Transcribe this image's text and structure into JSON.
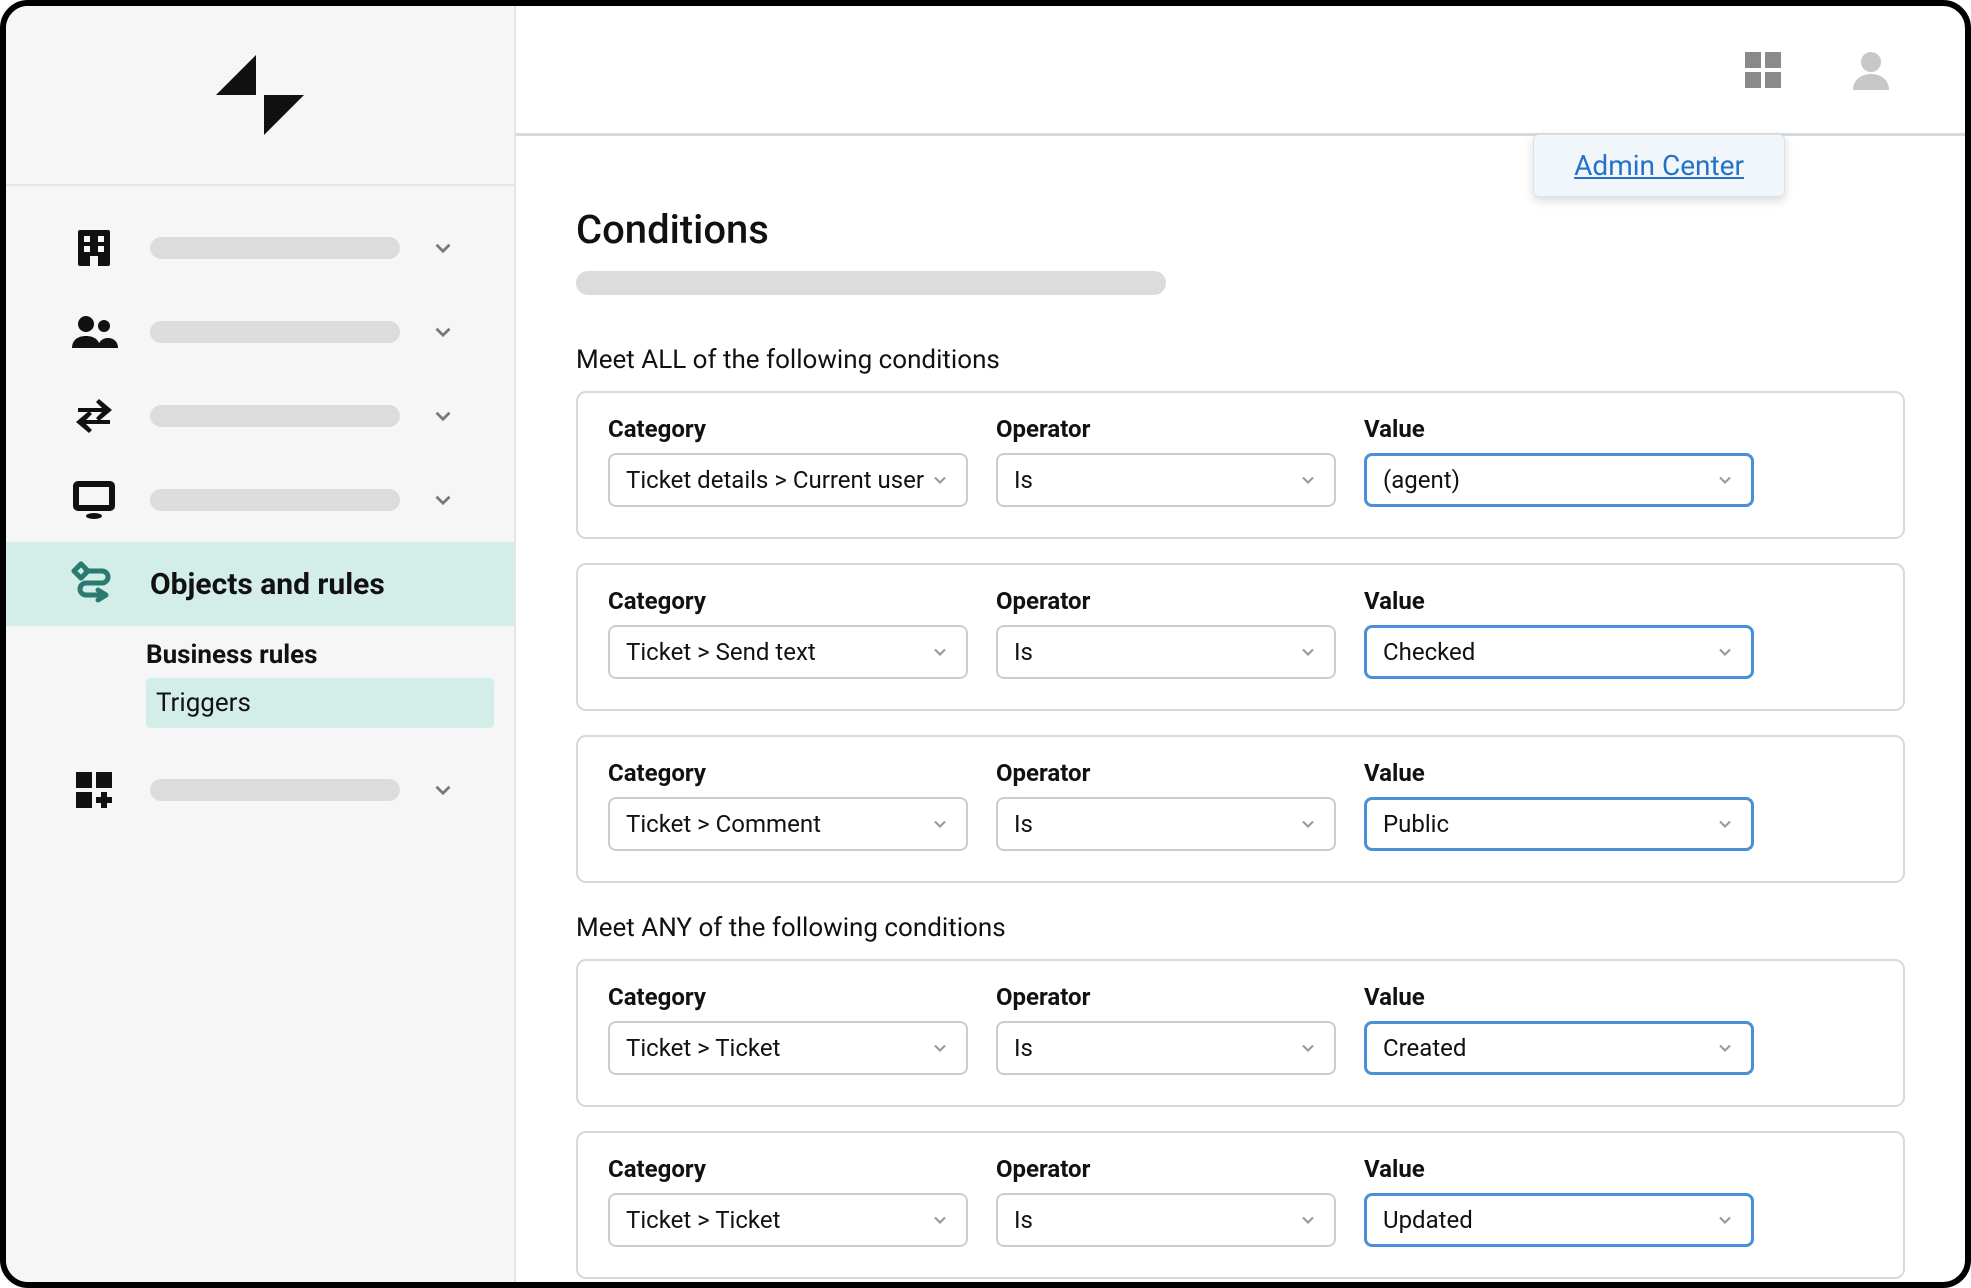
{
  "sidebar": {
    "active": {
      "label": "Objects and rules",
      "sub_section": "Business rules",
      "sub_item": "Triggers"
    }
  },
  "topbar": {
    "popup_link": "Admin Center"
  },
  "page": {
    "title": "Conditions",
    "all_label": "Meet ALL of the following conditions",
    "any_label": "Meet ANY of the following conditions",
    "col_labels": {
      "category": "Category",
      "operator": "Operator",
      "value": "Value"
    },
    "all_conditions": [
      {
        "category": "Ticket details > Current user",
        "operator": "Is",
        "value": "(agent)"
      },
      {
        "category": "Ticket > Send text",
        "operator": "Is",
        "value": "Checked"
      },
      {
        "category": "Ticket > Comment",
        "operator": "Is",
        "value": "Public"
      }
    ],
    "any_conditions": [
      {
        "category": "Ticket > Ticket",
        "operator": "Is",
        "value": "Created"
      },
      {
        "category": "Ticket > Ticket",
        "operator": "Is",
        "value": "Updated"
      }
    ]
  }
}
